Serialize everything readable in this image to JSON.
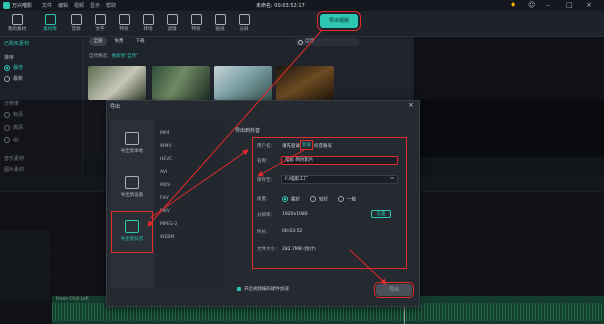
{
  "app": {
    "name": "万兴喵影",
    "unsaved": "未命名: 00:03:52:17"
  },
  "menu": [
    "文件",
    "编辑",
    "视频",
    "显示",
    "帮助"
  ],
  "toolbar": {
    "tabs": [
      {
        "label": "我的素材"
      },
      {
        "label": "素材库"
      },
      {
        "label": "音频"
      },
      {
        "label": "文字"
      },
      {
        "label": "特效"
      },
      {
        "label": "转场"
      },
      {
        "label": "滤镜"
      },
      {
        "label": "特效"
      },
      {
        "label": "贴纸"
      },
      {
        "label": "分屏"
      }
    ],
    "export_label": "导出视频"
  },
  "left_panel": {
    "tree_top": "已购买素材",
    "sort_label": "排序",
    "sort_opts": [
      "最佳",
      "最新"
    ],
    "res_label": "分辨率",
    "res_opts": [
      "标清",
      "高清",
      "4k"
    ],
    "cat1": "音乐素材",
    "cat2": "图片素材"
  },
  "media": {
    "pills": [
      "全部",
      "免费",
      "下载"
    ],
    "search_value": "自然",
    "filter_prefix": "自然精选：",
    "filter_hl": "搜索到\"自然\"",
    "thumb_captions": [
      "",
      "",
      "",
      ""
    ]
  },
  "dialog": {
    "title": "导出",
    "destinations": [
      {
        "label": "导出到本地",
        "icon": "computer-icon"
      },
      {
        "label": "导出到设备",
        "icon": "device-icon"
      },
      {
        "label": "导出到抖音",
        "icon": "douyin-icon"
      }
    ],
    "formats": [
      "MP4",
      "WMV",
      "HEVC",
      "AVI",
      "MOV",
      "F4V",
      "MKV",
      "MPEG-2",
      "WEBM"
    ],
    "section_title": "导出到抖音",
    "account_label": "用户名：",
    "account_value": "请先登录",
    "account_link": "登录",
    "account_tail": "抖音账号",
    "name_label": "名称：",
    "name_value": "喵影 简约影片",
    "saveto_label": "保存至：",
    "saveto_value": "F:/喵影工厂",
    "quality_label": "质量：",
    "quality_opts": [
      "最好",
      "较好",
      "一般"
    ],
    "resolution_label": "分辨率：",
    "resolution_value": "1920x1080",
    "settings_btn": "设置",
    "duration_label": "时长：",
    "duration_value": "00:03:52",
    "size_label": "文件大小：",
    "size_value": "282.7MB (估计)",
    "hw_label": "开启视频编码硬件加速",
    "export_btn": "导出"
  },
  "audio": {
    "clip_name": "Fresh Chill Lofi"
  }
}
